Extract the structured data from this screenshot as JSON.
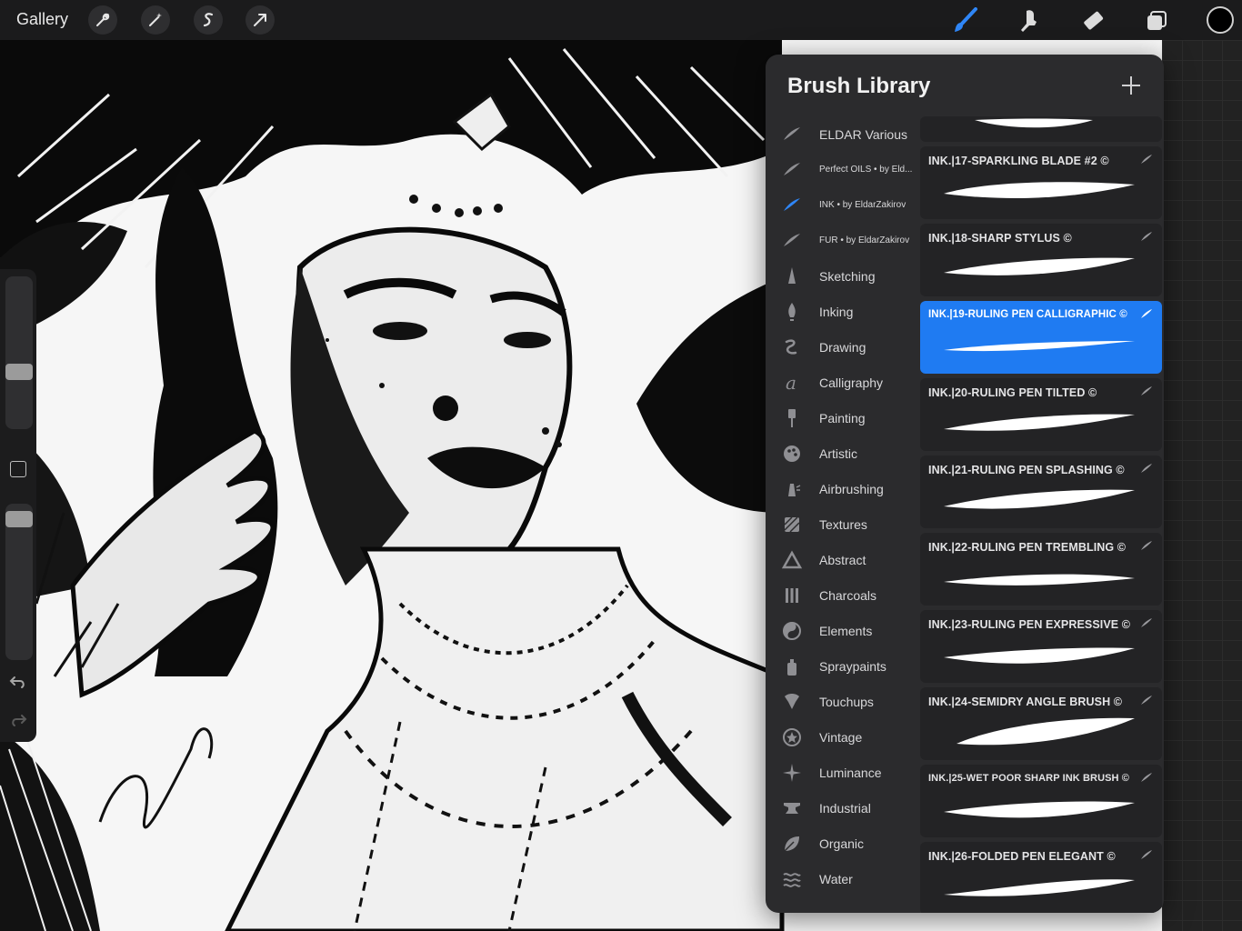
{
  "topbar": {
    "gallery_label": "Gallery",
    "tools_left": [
      "wrench-icon",
      "magic-wand-icon",
      "selection-icon",
      "transform-arrow-icon"
    ],
    "tools_right": [
      "brush-icon",
      "smudge-icon",
      "eraser-icon",
      "layers-icon"
    ],
    "active_tool": "brush-icon",
    "active_tool_color": "#2f86f6",
    "current_color": "#000000"
  },
  "sidebar": {
    "size_slider_level": 0.36,
    "opacity_slider_level": 0.95,
    "undo_icon": "undo-icon",
    "redo_icon": "redo-icon"
  },
  "brush_library": {
    "title": "Brush Library",
    "add_icon": "plus-icon",
    "sets": [
      {
        "label": "ELDAR Various",
        "icon": "brush-stroke-icon",
        "small": false
      },
      {
        "label": "Perfect OILS • by Eld...",
        "icon": "brush-stroke-icon",
        "small": true
      },
      {
        "label": "INK • by EldarZakirov",
        "icon": "brush-stroke-icon",
        "small": true,
        "selected": true
      },
      {
        "label": "FUR • by EldarZakirov",
        "icon": "brush-stroke-icon",
        "small": true
      },
      {
        "label": "Sketching",
        "icon": "pencil-icon"
      },
      {
        "label": "Inking",
        "icon": "pen-nib-icon"
      },
      {
        "label": "Drawing",
        "icon": "squiggle-icon"
      },
      {
        "label": "Calligraphy",
        "icon": "script-a-icon"
      },
      {
        "label": "Painting",
        "icon": "paint-brush-icon"
      },
      {
        "label": "Artistic",
        "icon": "palette-icon"
      },
      {
        "label": "Airbrushing",
        "icon": "airbrush-icon"
      },
      {
        "label": "Textures",
        "icon": "texture-icon"
      },
      {
        "label": "Abstract",
        "icon": "triangle-icon"
      },
      {
        "label": "Charcoals",
        "icon": "charcoal-icon"
      },
      {
        "label": "Elements",
        "icon": "yin-yang-icon"
      },
      {
        "label": "Spraypaints",
        "icon": "spray-can-icon"
      },
      {
        "label": "Touchups",
        "icon": "touchup-icon"
      },
      {
        "label": "Vintage",
        "icon": "star-badge-icon"
      },
      {
        "label": "Luminance",
        "icon": "sparkle-icon"
      },
      {
        "label": "Industrial",
        "icon": "anvil-icon"
      },
      {
        "label": "Organic",
        "icon": "leaf-icon"
      },
      {
        "label": "Water",
        "icon": "waves-icon"
      }
    ],
    "brushes": [
      {
        "name": "INK.|17-SPARKLING BLADE #2 ©"
      },
      {
        "name": "INK.|18-SHARP STYLUS ©"
      },
      {
        "name": "INK.|19-RULING PEN CALLIGRAPHIC ©",
        "selected": true
      },
      {
        "name": "INK.|20-RULING PEN TILTED ©"
      },
      {
        "name": "INK.|21-RULING PEN SPLASHING ©"
      },
      {
        "name": "INK.|22-RULING PEN TREMBLING ©"
      },
      {
        "name": "INK.|23-RULING PEN EXPRESSIVE ©"
      },
      {
        "name": "INK.|24-SEMIDRY ANGLE BRUSH ©"
      },
      {
        "name": "INK.|25-WET POOR SHARP INK BRUSH ©",
        "small": true
      },
      {
        "name": "INK.|26-FOLDED PEN ELEGANT ©"
      }
    ]
  }
}
